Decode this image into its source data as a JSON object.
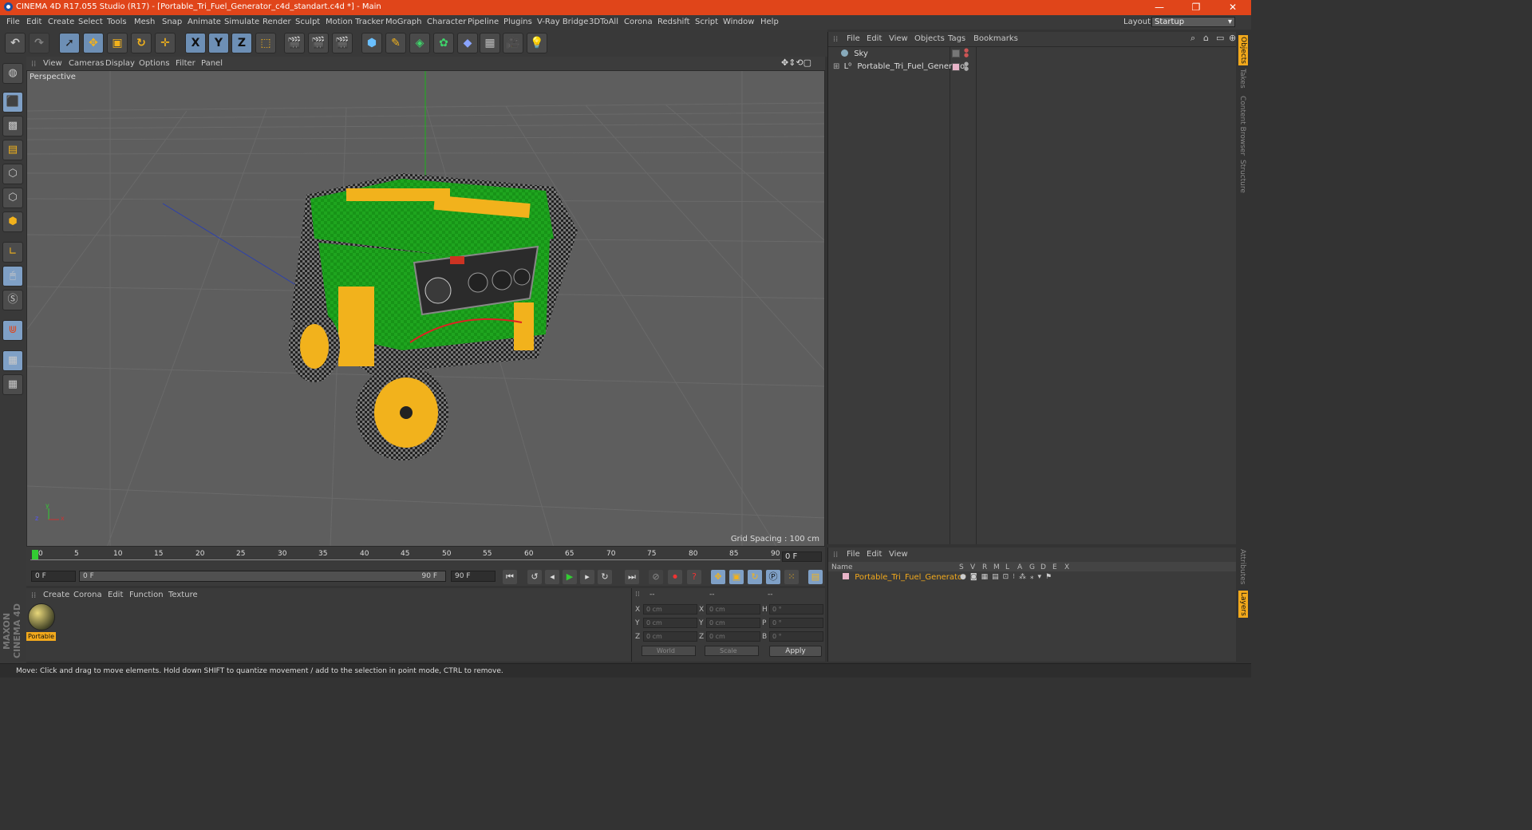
{
  "window": {
    "title": "CINEMA 4D R17.055 Studio (R17) - [Portable_Tri_Fuel_Generator_c4d_standart.c4d *] - Main",
    "minimize": "—",
    "maximize": "❐",
    "close": "✕"
  },
  "menubar": {
    "items": [
      "File",
      "Edit",
      "Create",
      "Select",
      "Tools",
      "Mesh",
      "Snap",
      "Animate",
      "Simulate",
      "Render",
      "Sculpt",
      "Motion Tracker",
      "MoGraph",
      "Character",
      "Pipeline",
      "Plugins",
      "V-Ray Bridge",
      "3DToAll",
      "Corona",
      "Redshift",
      "Script",
      "Window",
      "Help"
    ],
    "layout_label": "Layout:",
    "layout_value": "Startup"
  },
  "toolbar": {
    "axis_x": "X",
    "axis_y": "Y",
    "axis_z": "Z"
  },
  "viewport": {
    "menu": [
      "View",
      "Cameras",
      "Display",
      "Options",
      "Filter",
      "Panel"
    ],
    "label": "Perspective",
    "grid_spacing": "Grid Spacing : 100 cm",
    "axis_x": "x",
    "axis_y": "y",
    "axis_z": "z"
  },
  "timeline": {
    "ticks": [
      "0",
      "5",
      "10",
      "15",
      "20",
      "25",
      "30",
      "35",
      "40",
      "45",
      "50",
      "55",
      "60",
      "65",
      "70",
      "75",
      "80",
      "85",
      "90"
    ],
    "current_frame": "0 F"
  },
  "playbar": {
    "start": "0 F",
    "range_start": "0 F",
    "range_end": "90 F",
    "end": "90 F"
  },
  "material_manager": {
    "menu": [
      "Create",
      "Corona",
      "Edit",
      "Function",
      "Texture"
    ],
    "material_name": "Portable"
  },
  "coordinates": {
    "headers": [
      "--",
      "--",
      "--"
    ],
    "rows": [
      {
        "a": "X",
        "av": "0 cm",
        "b": "X",
        "bv": "0 cm",
        "c": "H",
        "cv": "0 °"
      },
      {
        "a": "Y",
        "av": "0 cm",
        "b": "Y",
        "bv": "0 cm",
        "c": "P",
        "cv": "0 °"
      },
      {
        "a": "Z",
        "av": "0 cm",
        "b": "Z",
        "bv": "0 cm",
        "c": "B",
        "cv": "0 °"
      }
    ],
    "mode1": "World",
    "mode2": "Scale",
    "apply": "Apply"
  },
  "object_manager": {
    "menu": [
      "File",
      "Edit",
      "View",
      "Objects",
      "Tags",
      "Bookmarks"
    ],
    "objects": [
      "Sky",
      "Portable_Tri_Fuel_Generator"
    ]
  },
  "attribute_manager": {
    "menu": [
      "File",
      "Edit",
      "View"
    ],
    "col_name": "Name",
    "cols": [
      "S",
      "V",
      "R",
      "M",
      "L",
      "A",
      "G",
      "D",
      "E",
      "X"
    ],
    "row": "Portable_Tri_Fuel_Generator"
  },
  "side_tabs": [
    "Objects",
    "Takes",
    "Content Browser",
    "Structure",
    "Attributes",
    "Layers"
  ],
  "status": "Move: Click and drag to move elements. Hold down SHIFT to quantize movement / add to the selection in point mode, CTRL to remove.",
  "maxon_logo": "MAXON CINEMA 4D",
  "colors": {
    "accent": "#e0451a",
    "selection": "#f2a91c",
    "generator_body": "#1fa51f",
    "generator_frame": "#f2b21c"
  }
}
